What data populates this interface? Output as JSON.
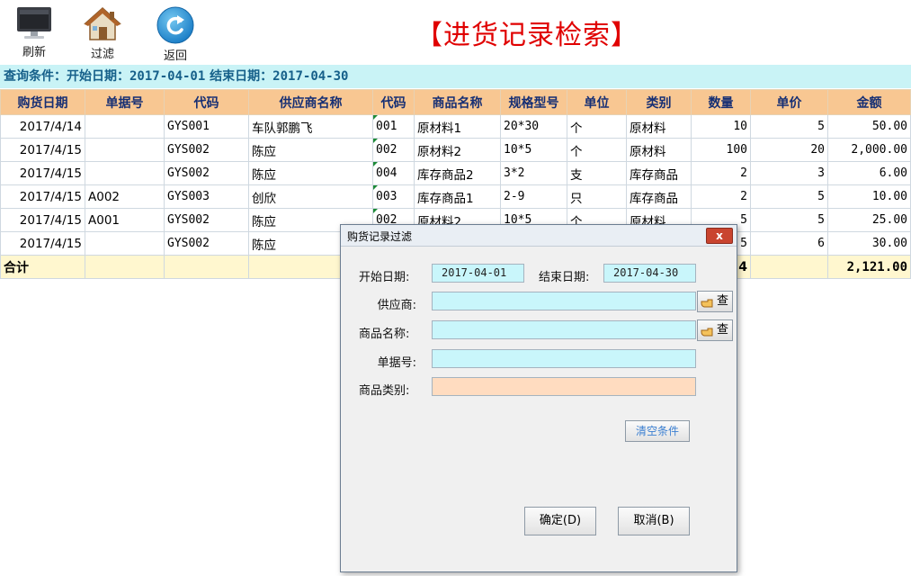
{
  "toolbar": {
    "refresh_label": "刷新",
    "filter_label": "过滤",
    "back_label": "返回"
  },
  "page_title": "【进货记录检索】",
  "query_conditions": {
    "prefix": "查询条件：开始日期：",
    "start_date": "2017-04-01",
    "end_label": " 结束日期：",
    "end_date": "2017-04-30"
  },
  "table": {
    "columns": [
      "购货日期",
      "单据号",
      "代码",
      "供应商名称",
      "代码",
      "商品名称",
      "规格型号",
      "单位",
      "类别",
      "数量",
      "单价",
      "金额"
    ],
    "rows": [
      [
        "2017/4/14",
        "",
        "GYS001",
        "车队郭鹏飞",
        "001",
        "原材料1",
        "20*30",
        "个",
        "原材料",
        "10",
        "5",
        "50.00"
      ],
      [
        "2017/4/15",
        "",
        "GYS002",
        "陈应",
        "002",
        "原材料2",
        "10*5",
        "个",
        "原材料",
        "100",
        "20",
        "2,000.00"
      ],
      [
        "2017/4/15",
        "",
        "GYS002",
        "陈应",
        "004",
        "库存商品2",
        "3*2",
        "支",
        "库存商品",
        "2",
        "3",
        "6.00"
      ],
      [
        "2017/4/15",
        "A002",
        "GYS003",
        "创欣",
        "003",
        "库存商品1",
        "2-9",
        "只",
        "库存商品",
        "2",
        "5",
        "10.00"
      ],
      [
        "2017/4/15",
        "A001",
        "GYS002",
        "陈应",
        "002",
        "原材料2",
        "10*5",
        "个",
        "原材料",
        "5",
        "5",
        "25.00"
      ],
      [
        "2017/4/15",
        "",
        "GYS002",
        "陈应",
        "",
        "",
        "",
        "",
        "",
        "5",
        "6",
        "30.00"
      ]
    ],
    "total_label": "合计",
    "total_quantity": "4",
    "total_amount": "2,121.00"
  },
  "dialog": {
    "title": "购货记录过滤",
    "close_symbol": "x",
    "start_label": "开始日期:",
    "start_value": "2017-04-01",
    "end_label": "结束日期:",
    "end_value": "2017-04-30",
    "supplier_label": "供应商:",
    "supplier_value": "",
    "product_label": "商品名称:",
    "product_value": "",
    "doc_label": "单据号:",
    "doc_value": "",
    "category_label": "商品类别:",
    "category_value": "",
    "lookup_label": "查",
    "clear_label": "清空条件",
    "ok_label": "确定(D)",
    "cancel_label": "取消(B)"
  },
  "colors": {
    "title": "#e00000",
    "header_bg": "#f8c792",
    "condition_bg": "#c9f3f6",
    "input_bg": "#c9f6fb",
    "category_input_bg": "#ffdcc0",
    "total_bg": "#fff7cf"
  }
}
